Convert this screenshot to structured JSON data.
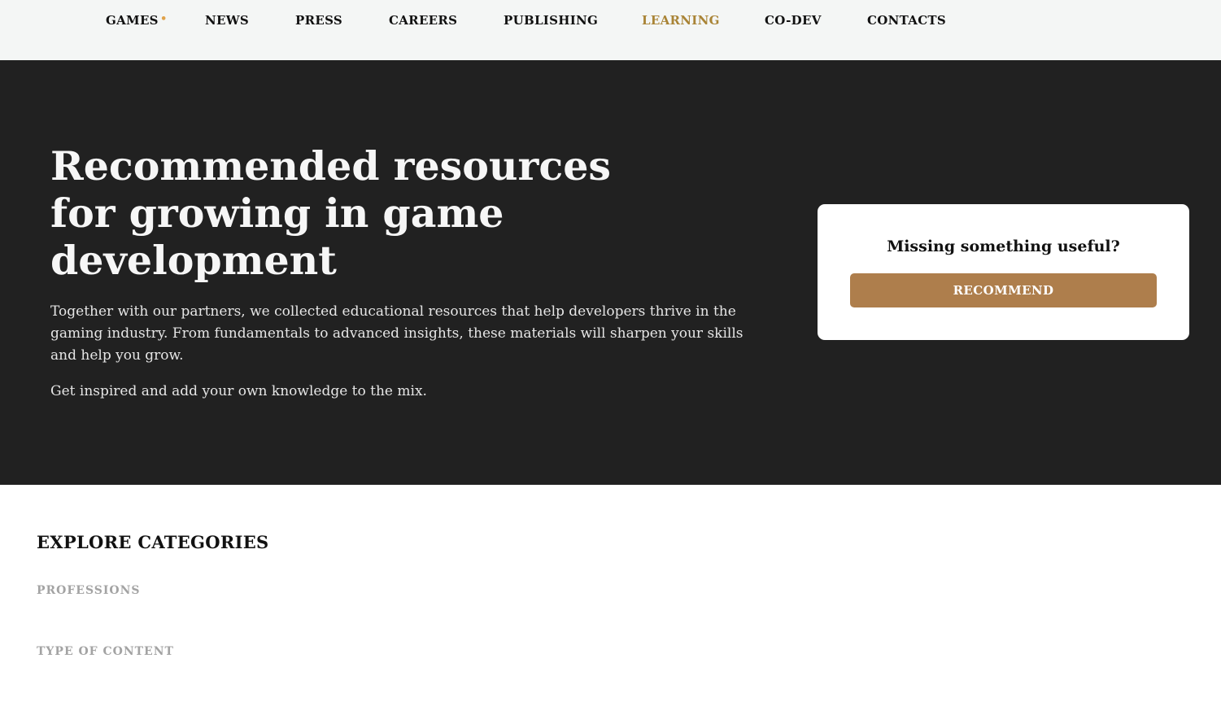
{
  "nav": {
    "items": [
      {
        "label": "GAMES",
        "active": false
      },
      {
        "label": "NEWS",
        "active": false
      },
      {
        "label": "PRESS",
        "active": false
      },
      {
        "label": "CAREERS",
        "active": false
      },
      {
        "label": "PUBLISHING",
        "active": false
      },
      {
        "label": "LEARNING",
        "active": true
      },
      {
        "label": "CO-DEV",
        "active": false
      },
      {
        "label": "CONTACTS",
        "active": false
      }
    ],
    "dot": "•"
  },
  "hero": {
    "title": "Recommended resources for growing in game development",
    "paragraph1": "Together with our partners, we collected educational resources that help developers thrive in the gaming industry. From fundamentals to advanced insights, these materials will sharpen your skills and help you grow.",
    "paragraph2": "Get inspired and add your own knowledge to the mix."
  },
  "card": {
    "title": "Missing something useful?",
    "button_label": "RECOMMEND"
  },
  "explore": {
    "title": "EXPLORE CATEGORIES",
    "categories": [
      {
        "label": "PROFESSIONS"
      },
      {
        "label": "TYPE OF CONTENT"
      }
    ]
  },
  "colors": {
    "accent": "#a98436",
    "button": "#ae7e4c",
    "hero_bg": "#212121",
    "nav_bg": "#f4f6f5"
  }
}
